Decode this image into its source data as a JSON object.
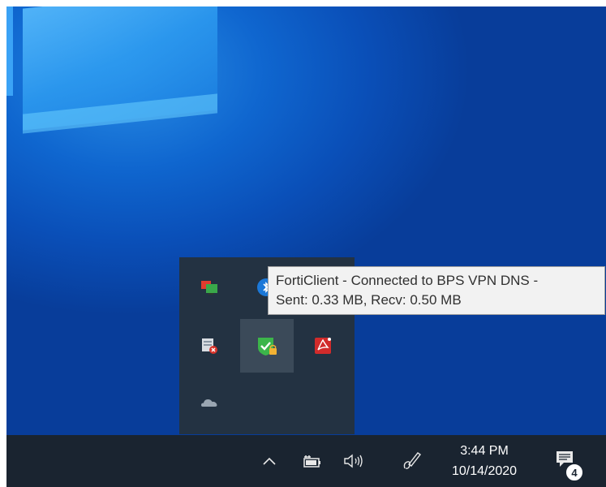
{
  "tooltip": {
    "line1": "FortiClient - Connected to BPS VPN DNS -",
    "line2": "Sent: 0.33 MB, Recv: 0.50 MB"
  },
  "overflow_icons": [
    {
      "name": "remote-desktop-icon",
      "active": false
    },
    {
      "name": "bluetooth-icon",
      "active": false
    },
    {
      "name": "task-scheduler-icon",
      "active": false
    },
    {
      "name": "forticlient-icon",
      "active": true
    },
    {
      "name": "adobe-acrobat-icon",
      "active": false
    },
    {
      "name": "onedrive-icon",
      "active": false
    }
  ],
  "taskbar": {
    "time": "3:44 PM",
    "date": "10/14/2020",
    "notification_count": "4",
    "icons": [
      "show-hidden-icons-chevron",
      "battery-icon",
      "volume-icon",
      "pen-icon",
      "action-center-icon"
    ]
  },
  "colors": {
    "taskbar": "#1a2430",
    "flyout": "#233242",
    "tooltip_bg": "#f2f2f2",
    "forticlient_green": "#3cb54a"
  }
}
